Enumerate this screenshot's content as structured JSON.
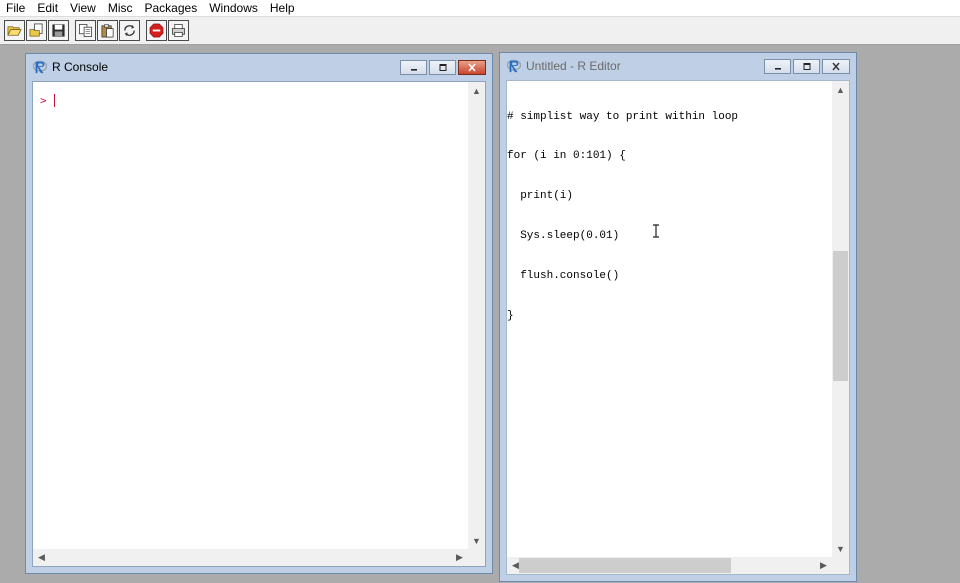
{
  "menubar": {
    "items": [
      "File",
      "Edit",
      "View",
      "Misc",
      "Packages",
      "Windows",
      "Help"
    ]
  },
  "toolbar": {
    "buttons": [
      "open-script-icon",
      "load-workspace-icon",
      "save-icon",
      "copy-icon",
      "paste-icon",
      "refresh-icon",
      "stop-icon",
      "print-icon"
    ]
  },
  "console": {
    "title": "R Console",
    "prompt": ">"
  },
  "editor": {
    "title": "Untitled - R Editor",
    "lines": [
      "# simplist way to print within loop",
      "for (i in 0:101) {",
      "  print(i)",
      "  Sys.sleep(0.01)",
      "  flush.console()",
      "}"
    ],
    "vscroll_fraction": 0.5
  },
  "colors": {
    "prompt": "#c8163a",
    "window_frame": "#bfd0e6",
    "desktop": "#ababab",
    "logo_blue": "#276dc3"
  }
}
